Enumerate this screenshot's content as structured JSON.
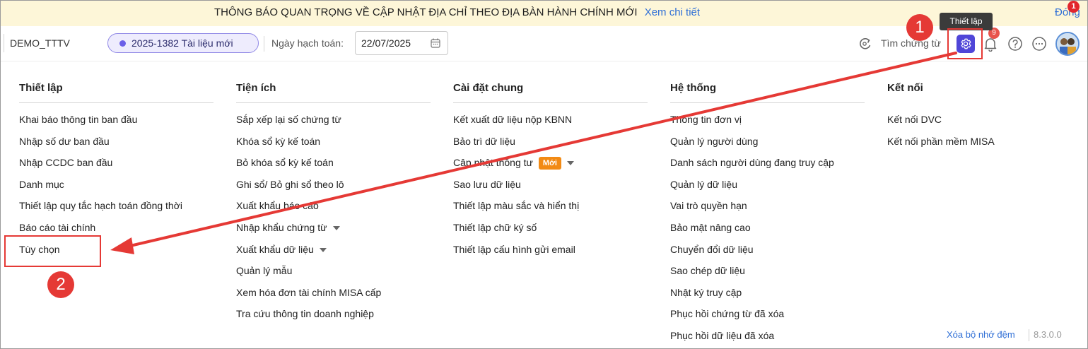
{
  "banner": {
    "message": "THÔNG BÁO QUAN TRỌNG VỀ CẬP NHẬT ĐỊA CHỈ THEO ĐỊA BÀN HÀNH CHÍNH MỚI",
    "link": "Xem chi tiết",
    "close": "Đóng"
  },
  "header": {
    "company": "DEMO_TTTV",
    "period": "2025-1382 Tài liệu mới",
    "date_label": "Ngày hạch toán:",
    "date_value": "22/07/2025",
    "search_voucher": "Tìm chứng từ",
    "notification_count": "9",
    "avatar_badge": "1",
    "tooltip": "Thiết lập"
  },
  "columns": [
    {
      "title": "Thiết lập",
      "items": [
        {
          "label": "Khai báo thông tin ban đầu"
        },
        {
          "label": "Nhập số dư ban đầu"
        },
        {
          "label": "Nhập CCDC ban đầu"
        },
        {
          "label": "Danh mục"
        },
        {
          "label": "Thiết lập quy tắc hạch toán đồng thời"
        },
        {
          "label": "Báo cáo tài chính"
        },
        {
          "label": "Tùy chọn"
        }
      ]
    },
    {
      "title": "Tiện ích",
      "items": [
        {
          "label": "Sắp xếp lại số chứng từ"
        },
        {
          "label": "Khóa sổ kỳ kế toán"
        },
        {
          "label": "Bỏ khóa sổ kỳ kế toán"
        },
        {
          "label": "Ghi sổ/ Bỏ ghi sổ theo lô"
        },
        {
          "label": "Xuất khẩu báo cáo"
        },
        {
          "label": "Nhập khẩu chứng từ",
          "dropdown": true
        },
        {
          "label": "Xuất khẩu dữ liệu",
          "dropdown": true
        },
        {
          "label": "Quản lý mẫu"
        },
        {
          "label": "Xem hóa đơn tài chính MISA cấp"
        },
        {
          "label": "Tra cứu thông tin doanh nghiệp"
        }
      ]
    },
    {
      "title": "Cài đặt chung",
      "items": [
        {
          "label": "Kết xuất dữ liệu nộp KBNN"
        },
        {
          "label": "Bảo trì dữ liệu"
        },
        {
          "label": "Cập nhật thông tư",
          "badge": "Mới",
          "dropdown": true
        },
        {
          "label": "Sao lưu dữ liệu"
        },
        {
          "label": "Thiết lập màu sắc và hiển thị"
        },
        {
          "label": "Thiết lập chữ ký số"
        },
        {
          "label": "Thiết lập cấu hình gửi email"
        }
      ]
    },
    {
      "title": "Hệ thống",
      "items": [
        {
          "label": "Thông tin đơn vị"
        },
        {
          "label": "Quản lý người dùng"
        },
        {
          "label": "Danh sách người dùng đang truy cập"
        },
        {
          "label": "Quản lý dữ liệu"
        },
        {
          "label": "Vai trò quyền hạn"
        },
        {
          "label": "Bảo mật nâng cao"
        },
        {
          "label": "Chuyển đổi dữ liệu"
        },
        {
          "label": "Sao chép dữ liệu"
        },
        {
          "label": "Nhật ký truy cập"
        },
        {
          "label": "Phục hồi chứng từ đã xóa"
        },
        {
          "label": "Phục hồi dữ liệu đã xóa"
        }
      ]
    },
    {
      "title": "Kết nối",
      "items": [
        {
          "label": "Kết nối DVC"
        },
        {
          "label": "Kết nối phần mềm MISA"
        }
      ]
    }
  ],
  "footer": {
    "clear_cache": "Xóa bộ nhớ đệm",
    "version": "8.3.0.0"
  },
  "annotations": {
    "step1": "1",
    "step2": "2",
    "color": "#e53935"
  },
  "colors": {
    "accent": "#4f46d8",
    "banner_bg": "#fdf6d8",
    "link": "#2f6fd6",
    "new_badge": "#f28a14"
  },
  "icons": [
    "search-refresh-icon",
    "gear-icon",
    "bell-icon",
    "help-icon",
    "more-icon",
    "calendar-icon",
    "caret-down-icon"
  ]
}
